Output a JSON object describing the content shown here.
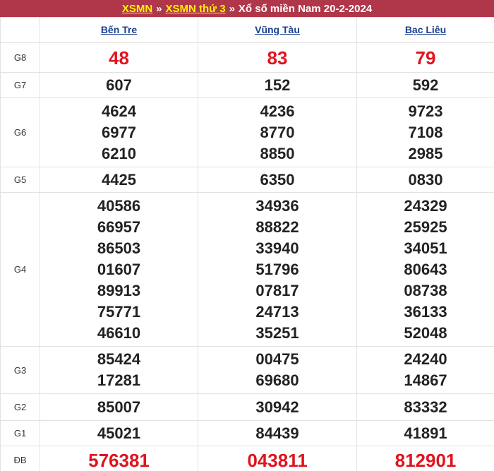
{
  "breadcrumb": {
    "link1": "XSMN",
    "sep1": "»",
    "link2": "XSMN thứ 3",
    "sep2": "»",
    "title": "Xổ số miền Nam 20-2-2024"
  },
  "provinces": [
    "Bến Tre",
    "Vũng Tàu",
    "Bạc Liêu"
  ],
  "prizes": [
    {
      "label": "G8",
      "numbers": [
        [
          "48"
        ],
        [
          "83"
        ],
        [
          "79"
        ]
      ]
    },
    {
      "label": "G7",
      "numbers": [
        [
          "607"
        ],
        [
          "152"
        ],
        [
          "592"
        ]
      ]
    },
    {
      "label": "G6",
      "numbers": [
        [
          "4624",
          "6977",
          "6210"
        ],
        [
          "4236",
          "8770",
          "8850"
        ],
        [
          "9723",
          "7108",
          "2985"
        ]
      ]
    },
    {
      "label": "G5",
      "numbers": [
        [
          "4425"
        ],
        [
          "6350"
        ],
        [
          "0830"
        ]
      ]
    },
    {
      "label": "G4",
      "numbers": [
        [
          "40586",
          "66957",
          "86503",
          "01607",
          "89913",
          "75771",
          "46610"
        ],
        [
          "34936",
          "88822",
          "33940",
          "51796",
          "07817",
          "24713",
          "35251"
        ],
        [
          "24329",
          "25925",
          "34051",
          "80643",
          "08738",
          "36133",
          "52048"
        ]
      ]
    },
    {
      "label": "G3",
      "numbers": [
        [
          "85424",
          "17281"
        ],
        [
          "00475",
          "69680"
        ],
        [
          "24240",
          "14867"
        ]
      ]
    },
    {
      "label": "G2",
      "numbers": [
        [
          "85007"
        ],
        [
          "30942"
        ],
        [
          "83332"
        ]
      ]
    },
    {
      "label": "G1",
      "numbers": [
        [
          "45021"
        ],
        [
          "84439"
        ],
        [
          "41891"
        ]
      ]
    },
    {
      "label": "ĐB",
      "numbers": [
        [
          "576381"
        ],
        [
          "043811"
        ],
        [
          "812901"
        ]
      ]
    }
  ]
}
